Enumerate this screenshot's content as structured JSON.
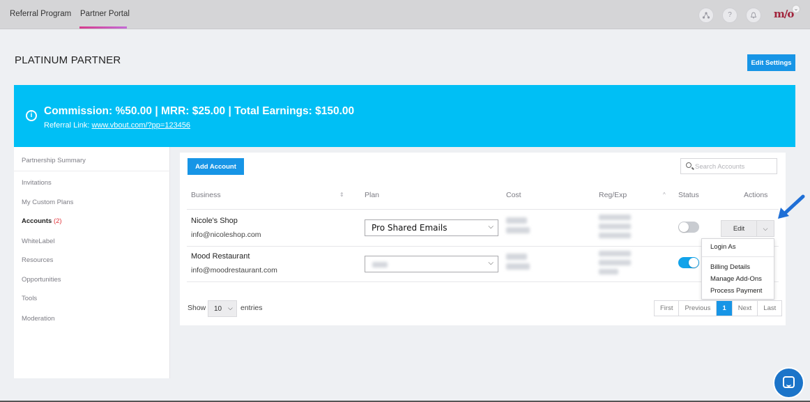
{
  "topbar": {
    "tabs": [
      "Referral Program",
      "Partner Portal"
    ],
    "icons": [
      "network-icon",
      "help-icon",
      "bell-icon"
    ],
    "help_glyph": "?",
    "logo_text": "m/o"
  },
  "page": {
    "title": "PLATINUM PARTNER",
    "edit_settings_label": "Edit Settings"
  },
  "banner": {
    "headline": "Commission: %50.00 | MRR: $25.00 | Total Earnings: $150.00",
    "link_label": "Referral Link:",
    "link_url": "www.vbout.com/?pp=123456",
    "bg_color": "#00bff5"
  },
  "sidebar": {
    "items": [
      {
        "label": "Partnership Summary"
      },
      {
        "label": "Invitations"
      },
      {
        "label": "My Custom Plans"
      },
      {
        "label": "Accounts",
        "count": "(2)"
      },
      {
        "label": "WhiteLabel"
      },
      {
        "label": "Resources"
      },
      {
        "label": "Opportunities"
      },
      {
        "label": "Tools"
      },
      {
        "label": "Moderation"
      }
    ]
  },
  "accounts": {
    "add_label": "Add Account",
    "search_placeholder": "Search Accounts",
    "columns": [
      "Business",
      "Plan",
      "Cost",
      "Reg/Exp",
      "Status",
      "Actions"
    ],
    "rows": [
      {
        "name": "Nicole's Shop",
        "email": "info@nicoleshop.com",
        "plan": "Pro Shared Emails",
        "status": "off"
      },
      {
        "name": "Mood Restaurant",
        "email": "info@moodrestaurant.com",
        "plan": "",
        "status": "on"
      }
    ],
    "edit_label": "Edit",
    "menu": [
      "Login As",
      "Billing Details",
      "Manage Add-Ons",
      "Process Payment"
    ]
  },
  "footer": {
    "show_label": "Show",
    "entries_value": "10",
    "entries_label": "entries",
    "pagination": [
      "First",
      "Previous",
      "1",
      "Next",
      "Last"
    ],
    "current_page": "1"
  },
  "colors": {
    "accent": "#1795e6",
    "toggle_on": "#12a3ea",
    "count_red": "#e2343b"
  }
}
